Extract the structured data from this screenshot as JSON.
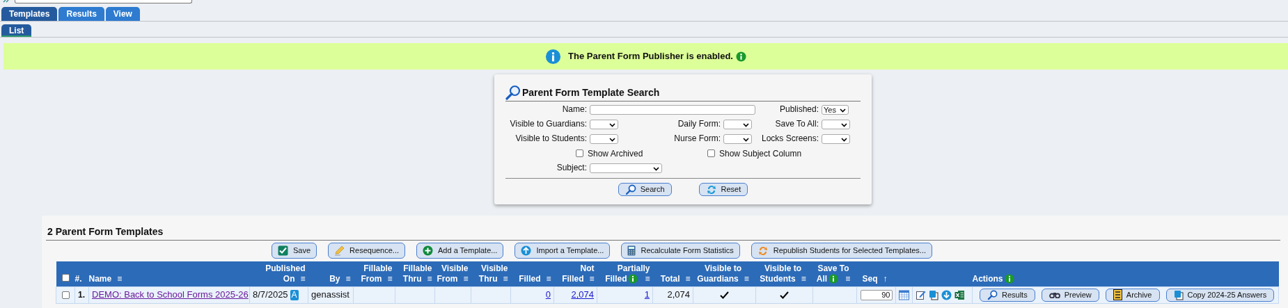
{
  "tabs": [
    {
      "label": "Templates",
      "selected": true
    },
    {
      "label": "Results",
      "selected": false
    },
    {
      "label": "View",
      "selected": false
    }
  ],
  "subtabs": [
    {
      "label": "List",
      "selected": true
    }
  ],
  "banner": {
    "text": "The Parent Form Publisher is enabled."
  },
  "search": {
    "title": "Parent Form Template Search",
    "fields": [
      {
        "kind": "text",
        "label": "Name:"
      },
      {
        "kind": "select",
        "label": "Published:",
        "value": "Yes"
      },
      {
        "kind": "select",
        "label": "Visible to Guardians:"
      },
      {
        "kind": "select",
        "label": "Daily Form:"
      },
      {
        "kind": "select",
        "label": "Save To All:"
      },
      {
        "kind": "select",
        "label": "Visible to Students:"
      },
      {
        "kind": "select",
        "label": "Nurse Form:"
      },
      {
        "kind": "select",
        "label": "Locks Screens:"
      },
      {
        "kind": "checkbox",
        "label": "Show Archived",
        "checked": false
      },
      {
        "kind": "checkbox",
        "label": "Show Subject Column",
        "checked": false
      },
      {
        "kind": "select",
        "label": "Subject:"
      }
    ],
    "buttons": [
      "Search",
      "Reset"
    ]
  },
  "list": {
    "title": "2 Parent Form Templates",
    "toolbar": [
      "Save",
      "Resequence...",
      "Add a Template...",
      "Import a Template...",
      "Recalculate Form Statistics",
      "Republish Students for Selected Templates..."
    ],
    "select_all": {
      "checked": false
    },
    "columns": [
      {
        "lines": [
          "#."
        ]
      },
      {
        "lines": [
          "Name"
        ],
        "menu": "≡"
      },
      {
        "lines": [
          "Published",
          "On"
        ],
        "menu": "≡"
      },
      {
        "lines": [
          "By"
        ],
        "menu": "≡"
      },
      {
        "lines": [
          "Fillable",
          "From"
        ],
        "menu": "≡"
      },
      {
        "lines": [
          "Fillable",
          "Thru"
        ],
        "menu": "≡"
      },
      {
        "lines": [
          "Visible",
          "From"
        ],
        "menu": "≡"
      },
      {
        "lines": [
          "Visible",
          "Thru"
        ],
        "menu": "≡"
      },
      {
        "lines": [
          "Filled"
        ],
        "menu": "≡"
      },
      {
        "lines": [
          "Not",
          "Filled"
        ],
        "menu": "≡"
      },
      {
        "lines": [
          "Partially",
          "Filled"
        ],
        "info": true,
        "menu": "≡"
      },
      {
        "lines": [
          "Total"
        ],
        "menu": "≡"
      },
      {
        "lines": [
          "Visible to",
          "Guardians"
        ],
        "menu": "≡"
      },
      {
        "lines": [
          "Visible to",
          "Students"
        ],
        "menu": "≡"
      },
      {
        "lines": [
          "Save To",
          "All"
        ],
        "info": true,
        "menu": "≡"
      },
      {
        "lines": [
          "Seq"
        ],
        "menu": "↑"
      },
      {
        "lines": [
          "Actions"
        ],
        "info": true
      }
    ],
    "rows": [
      {
        "selected": false,
        "number": "1.",
        "name": "DEMO: Back to School Forms 2025-26",
        "published_on": "8/7/2025",
        "published_badge": "A",
        "by": "genassist",
        "filled": "0",
        "not_filled": "2,074",
        "partially_filled": "1",
        "total": "2,074",
        "visible_to_guardians": true,
        "visible_to_students": true,
        "save_to_all": false,
        "seq": "90",
        "actions": [
          "Results",
          "Preview",
          "Archive",
          "Copy 2024-25 Answers"
        ]
      }
    ]
  }
}
